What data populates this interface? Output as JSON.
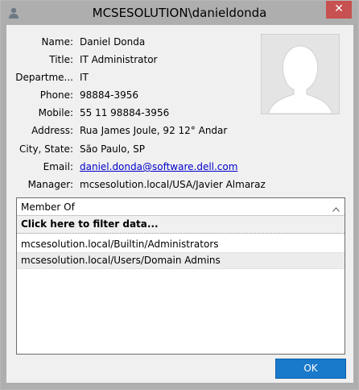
{
  "window": {
    "title": "MCSESOLUTION\\danieldonda",
    "close_glyph": "✕"
  },
  "fields": [
    {
      "label": "Name:",
      "value": "Daniel Donda",
      "link": false
    },
    {
      "label": "Title:",
      "value": "IT Administrator",
      "link": false
    },
    {
      "label": "Departme...",
      "value": "IT",
      "link": false
    },
    {
      "label": "Phone:",
      "value": "98884-3956",
      "link": false
    },
    {
      "label": "Mobile:",
      "value": "55 11 98884-3956",
      "link": false
    },
    {
      "label": "Address:",
      "value": "Rua James Joule, 92 12° Andar",
      "link": false
    },
    {
      "label": "City, State:",
      "value": "São Paulo, SP",
      "link": false
    },
    {
      "label": "Email:",
      "value": "daniel.donda@software.dell.com",
      "link": true
    },
    {
      "label": "Manager:",
      "value": "mcsesolution.local/USA/Javier Almaraz",
      "link": false
    }
  ],
  "member_of": {
    "header": "Member Of",
    "filter_text": "Click here to filter data...",
    "rows": [
      "mcsesolution.local/Builtin/Administrators",
      "mcsesolution.local/Users/Domain Admins"
    ]
  },
  "buttons": {
    "ok": "OK"
  },
  "colors": {
    "frame": "#aeaeae",
    "close": "#c75050",
    "ok_button": "#1979ca",
    "link": "#0000cc"
  },
  "icons": {
    "title": "user-icon",
    "photo": "default-avatar-silhouette",
    "sort": "chevron-up-icon"
  }
}
